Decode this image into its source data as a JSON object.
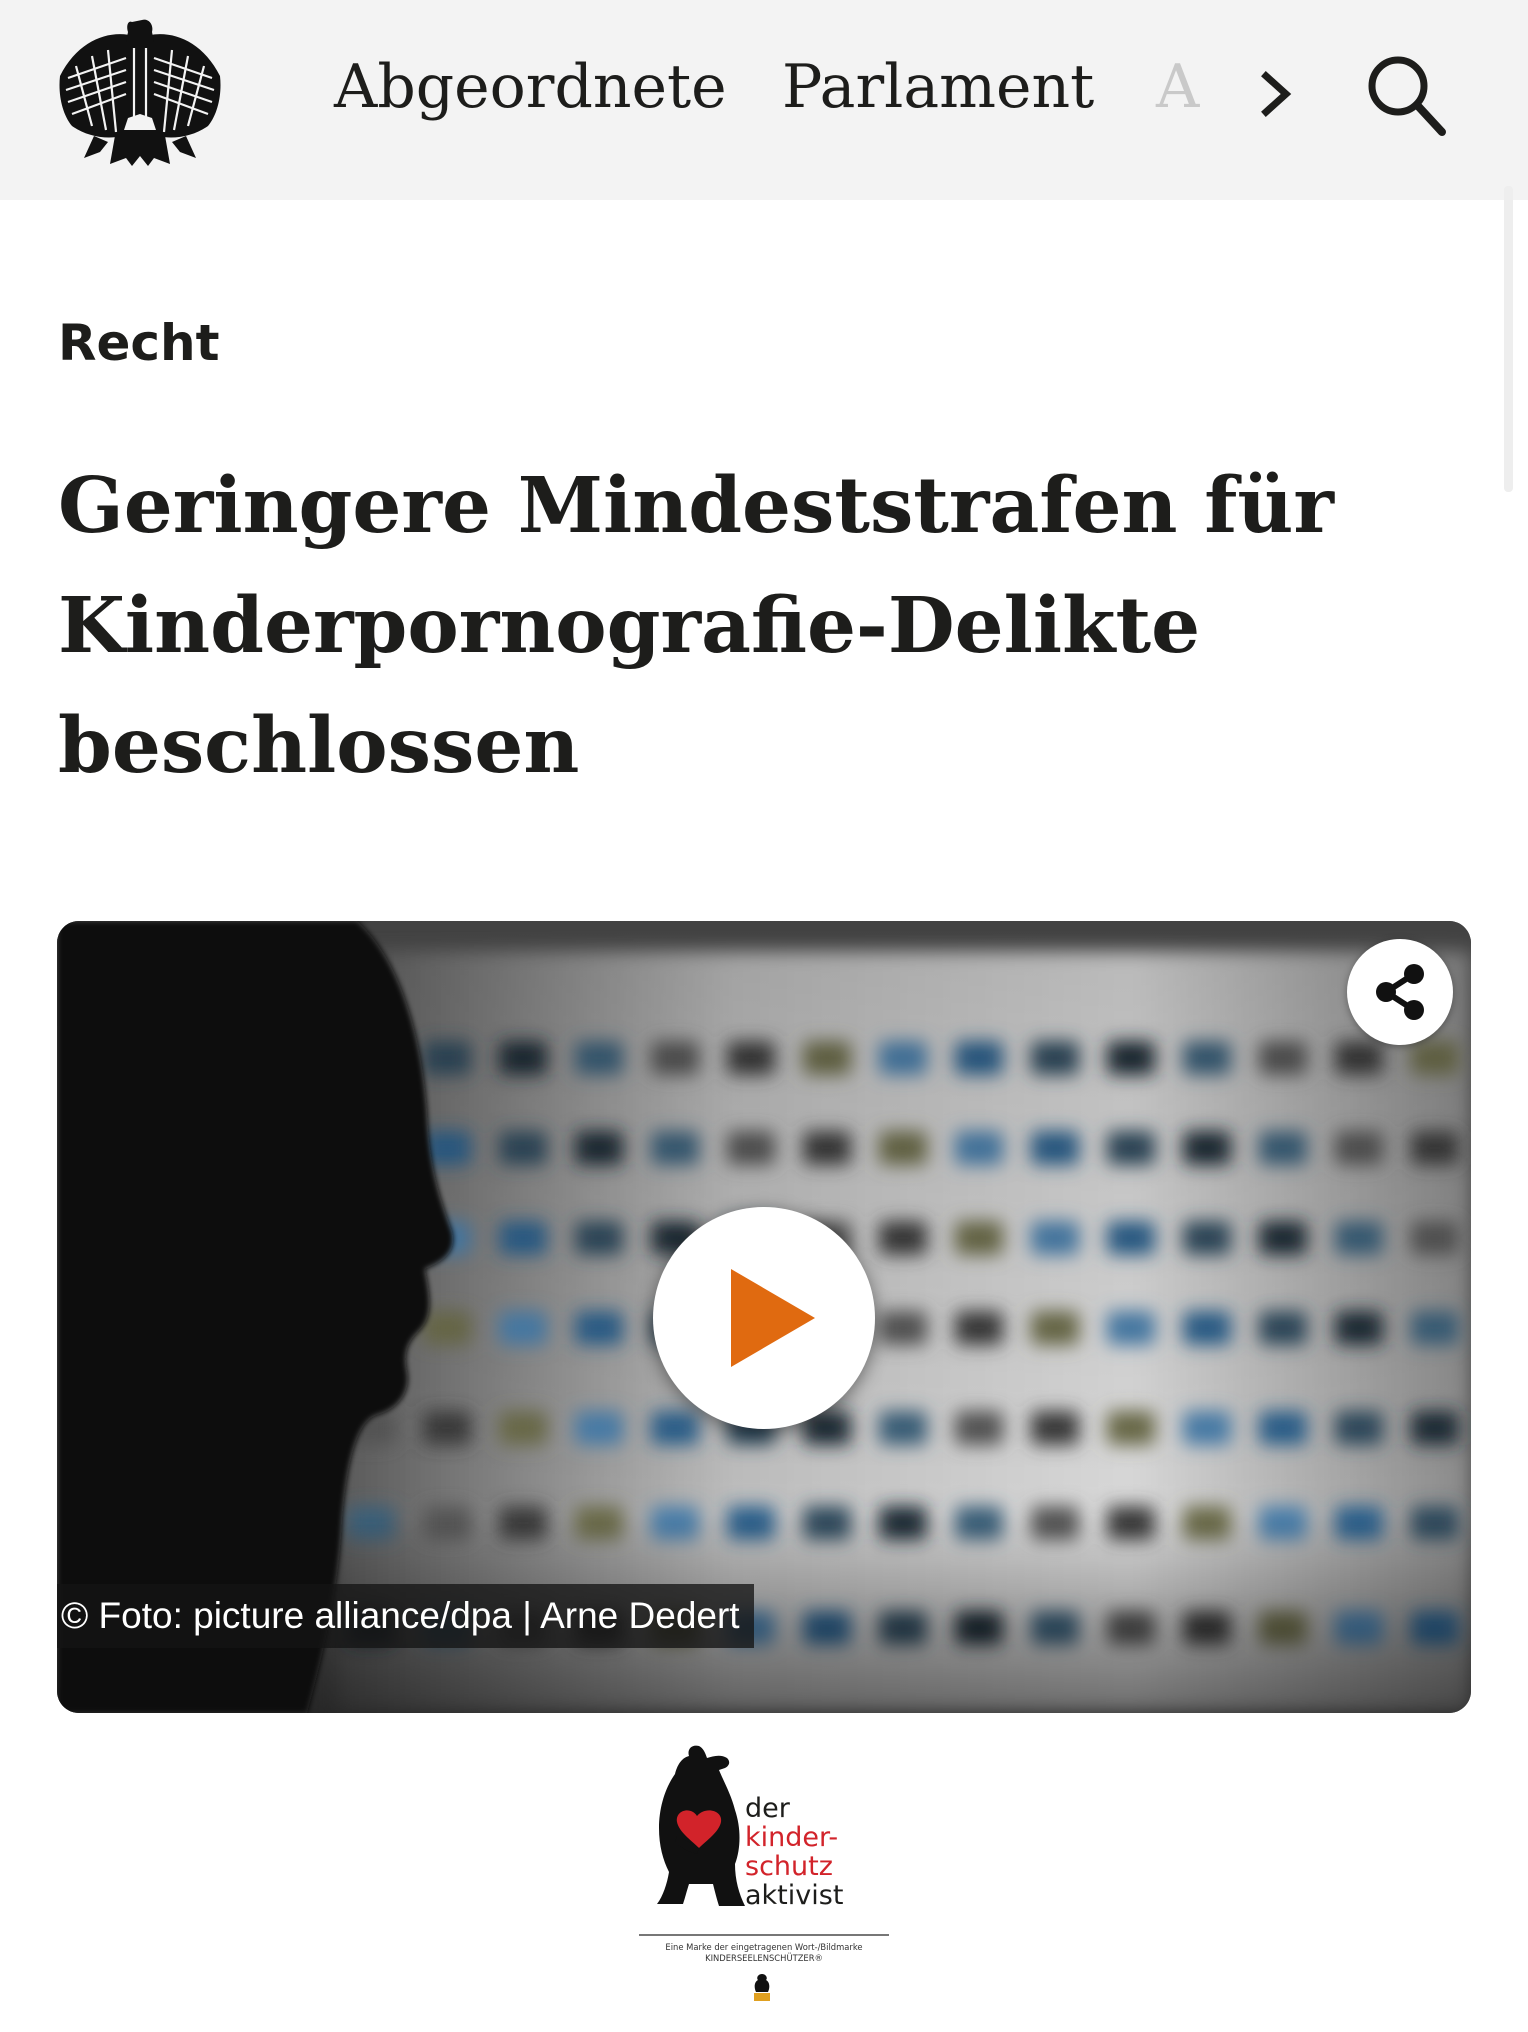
{
  "header": {
    "logo": "bundesadler-icon",
    "nav": [
      "Abgeordnete",
      "Parlament",
      "A"
    ],
    "more_icon": "chevron-right-icon",
    "search_icon": "search-icon"
  },
  "article": {
    "kicker": "Recht",
    "headline_lines": [
      "Geringere Mindeststrafen für",
      "Kinderpornografie-Delikte",
      "beschlossen"
    ]
  },
  "video": {
    "share_icon": "share-icon",
    "play_icon": "play-icon",
    "credit": "© Foto: picture alliance/dpa | Arne Dedert",
    "play_color": "#e06a10"
  },
  "watermark": {
    "lines": [
      "der",
      "kinder-",
      "schutz",
      "aktivist"
    ],
    "small_print": [
      "Eine Marke der eingetragenen Wort-/Bildmarke",
      "KINDERSEELENSCHÜTZER®"
    ],
    "heart_color": "#d2232a"
  }
}
